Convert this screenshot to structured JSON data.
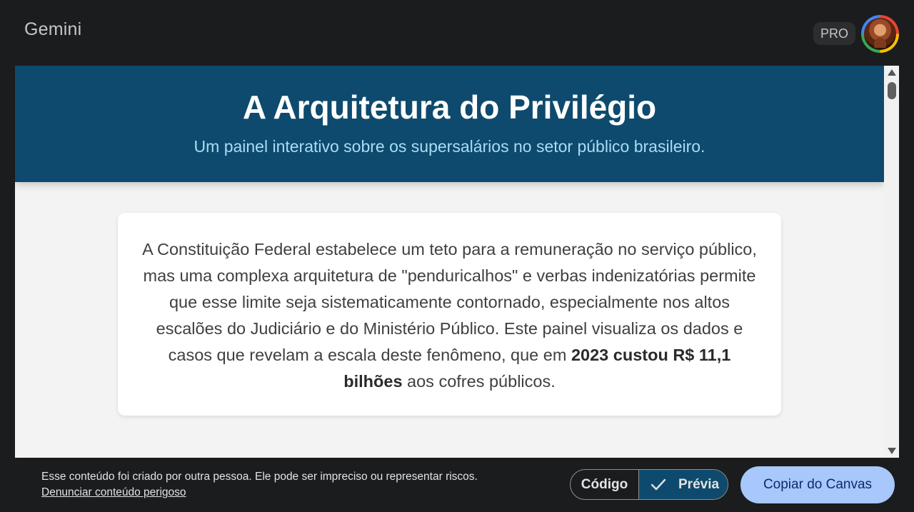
{
  "header": {
    "brand": "Gemini",
    "pro_badge": "PRO",
    "avatar_icon": "user-avatar-icon"
  },
  "canvas": {
    "hero": {
      "title": "A Arquitetura do Privilégio",
      "subtitle": "Um painel interativo sobre os supersalários no setor público brasileiro."
    },
    "intro": {
      "text_before": "A Constituição Federal estabelece um teto para a remuneração no serviço público, mas uma complexa arquitetura de \"penduricalhos\" e verbas indenizatórias permite que esse limite seja sistematicamente contornado, especialmente nos altos escalões do Judiciário e do Ministério Público. Este painel visualiza os dados e casos que revelam a escala deste fenômeno, que em ",
      "highlight": "2023 custou R$ 11,1 bilhões",
      "text_after": " aos cofres públicos."
    }
  },
  "footer": {
    "disclaimer": "Esse conteúdo foi criado por outra pessoa. Ele pode ser impreciso ou representar riscos.",
    "report_link": "Denunciar conteúdo perigoso",
    "code_label": "Código",
    "preview_label": "Prévia",
    "copy_label": "Copiar do Canvas"
  },
  "colors": {
    "hero_background": "#0e4a6e",
    "hero_subtitle": "#a9ddf5",
    "copy_button": "#a8c7fa",
    "app_background": "#1b1c1d"
  }
}
